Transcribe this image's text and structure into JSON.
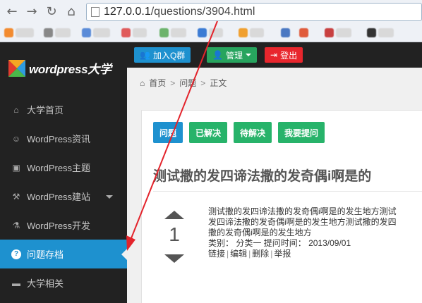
{
  "browser": {
    "url_host": "127.0.0.1",
    "url_path": "/questions/3904.html",
    "icons": [
      "back-icon",
      "forward-icon",
      "reload-icon",
      "home-icon",
      "page-icon"
    ]
  },
  "logo": {
    "text": "wordpress大学"
  },
  "sidebar": {
    "items": [
      {
        "label": "大学首页",
        "icon": "home-icon",
        "glyph": "⌂"
      },
      {
        "label": "WordPress资讯",
        "icon": "smile-icon",
        "glyph": "☺"
      },
      {
        "label": "WordPress主题",
        "icon": "picture-icon",
        "glyph": "▣"
      },
      {
        "label": "WordPress建站",
        "icon": "wrench-icon",
        "glyph": "⚒"
      },
      {
        "label": "WordPress开发",
        "icon": "flask-icon",
        "glyph": "⚗"
      },
      {
        "label": "问题存档",
        "icon": "question-icon",
        "glyph": "?"
      },
      {
        "label": "大学相关",
        "icon": "laptop-icon",
        "glyph": "▬"
      }
    ]
  },
  "topbar": {
    "join_qq": "加入Q群",
    "manage": "管理",
    "logout": "登出"
  },
  "breadcrumb": {
    "home": "首页",
    "questions": "问题",
    "current": "正文"
  },
  "tabs": [
    "问题",
    "已解决",
    "待解决",
    "我要提问"
  ],
  "question": {
    "title": "测试撒的发四谛法撒的发奇偶i啊是的",
    "votes": "1",
    "body_lines": [
      "测试撒的发四谛法撒的发奇偶i啊是的发生地方测试",
      "发四谛法撒的发奇偶i啊是的发生地方测试撒的发四",
      "撒的发奇偶i啊是的发生地方"
    ],
    "category_label": "类别：",
    "category": "分类一",
    "time_label": "提问时间：",
    "time": "2013/09/01",
    "actions": [
      "链接",
      "编辑",
      "删除",
      "举报"
    ]
  },
  "colors": {
    "sidebar_bg": "#222222",
    "active": "#1e91cf",
    "tab_blue": "#1e91cf",
    "tab_green": "#27b36a",
    "btn_blue": "#1e91cf",
    "btn_green": "#27a45e",
    "btn_red": "#e8262d",
    "annotation": "#e3232b"
  }
}
